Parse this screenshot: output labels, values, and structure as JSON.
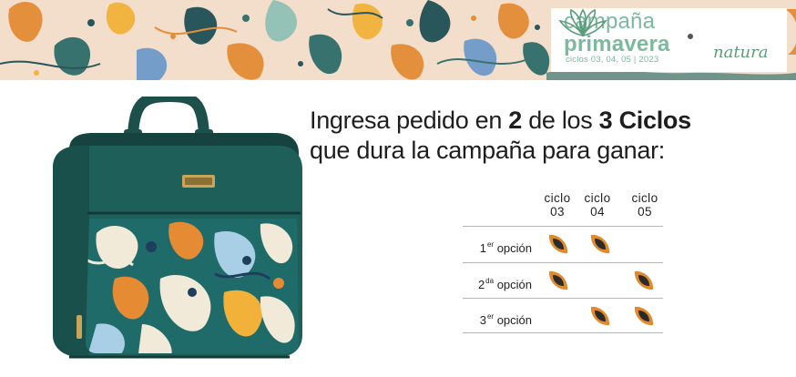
{
  "banner": {
    "campaign_line1": "campaña",
    "campaign_line2": "primavera",
    "cycles_line": "ciclos 03, 04, 05 | 2023",
    "brand_name": "natura",
    "bag_logo_icon": "natura-logo-icon"
  },
  "product": {
    "icon": "lunch-bag-image"
  },
  "headline": {
    "line1_a": "Ingresa pedido en ",
    "line1_b": "2",
    "line1_c": " de los ",
    "line1_d": "3 Ciclos",
    "line2": "que dura la campaña para ganar:"
  },
  "schedule": {
    "columns": [
      {
        "top": "ciclo",
        "bottom": "03"
      },
      {
        "top": "ciclo",
        "bottom": "04"
      },
      {
        "top": "ciclo",
        "bottom": "05"
      }
    ],
    "rows": [
      {
        "num": "1",
        "sup": "er",
        "label": " opción",
        "marks": [
          true,
          true,
          false
        ]
      },
      {
        "num": "2",
        "sup": "da",
        "label": " opción",
        "marks": [
          true,
          false,
          true
        ]
      },
      {
        "num": "3",
        "sup": "er",
        "label": " opción",
        "marks": [
          false,
          true,
          true
        ]
      }
    ],
    "mark_icon": "leaf-seed-icon",
    "colors": {
      "mark_fill": "#e08a2c",
      "mark_core": "#2b2b2b",
      "grid": "#b5b5b5"
    }
  },
  "colors": {
    "accent_green": "#7cb99d",
    "bag_teal": "#1f5f5a",
    "banner_bg": "#f3ddcb"
  }
}
